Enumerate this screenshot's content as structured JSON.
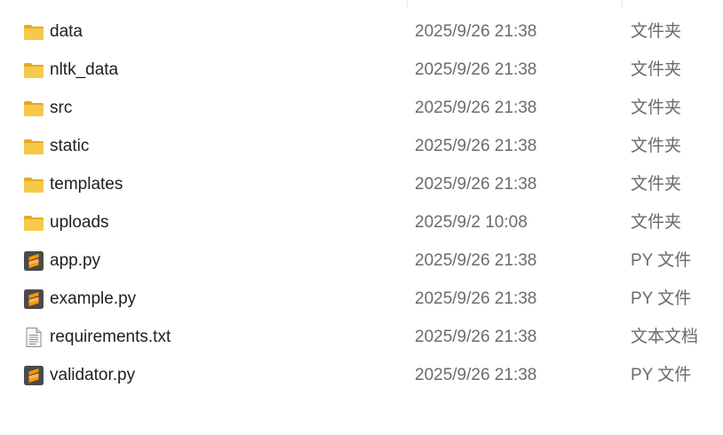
{
  "files": [
    {
      "name": "data",
      "modified": "2025/9/26 21:38",
      "type": "文件夹",
      "icon": "folder-icon"
    },
    {
      "name": "nltk_data",
      "modified": "2025/9/26 21:38",
      "type": "文件夹",
      "icon": "folder-icon"
    },
    {
      "name": "src",
      "modified": "2025/9/26 21:38",
      "type": "文件夹",
      "icon": "folder-icon"
    },
    {
      "name": "static",
      "modified": "2025/9/26 21:38",
      "type": "文件夹",
      "icon": "folder-icon"
    },
    {
      "name": "templates",
      "modified": "2025/9/26 21:38",
      "type": "文件夹",
      "icon": "folder-icon"
    },
    {
      "name": "uploads",
      "modified": "2025/9/2 10:08",
      "type": "文件夹",
      "icon": "folder-icon"
    },
    {
      "name": "app.py",
      "modified": "2025/9/26 21:38",
      "type": "PY 文件",
      "icon": "sublime-file-icon"
    },
    {
      "name": "example.py",
      "modified": "2025/9/26 21:38",
      "type": "PY 文件",
      "icon": "sublime-file-icon"
    },
    {
      "name": "requirements.txt",
      "modified": "2025/9/26 21:38",
      "type": "文本文档",
      "icon": "text-file-icon"
    },
    {
      "name": "validator.py",
      "modified": "2025/9/26 21:38",
      "type": "PY 文件",
      "icon": "sublime-file-icon"
    }
  ],
  "colors": {
    "folder_body": "#f7c948",
    "folder_tab": "#e8a825",
    "sublime_bg": "#4a4a4a",
    "sublime_accent": "#ff9800"
  }
}
